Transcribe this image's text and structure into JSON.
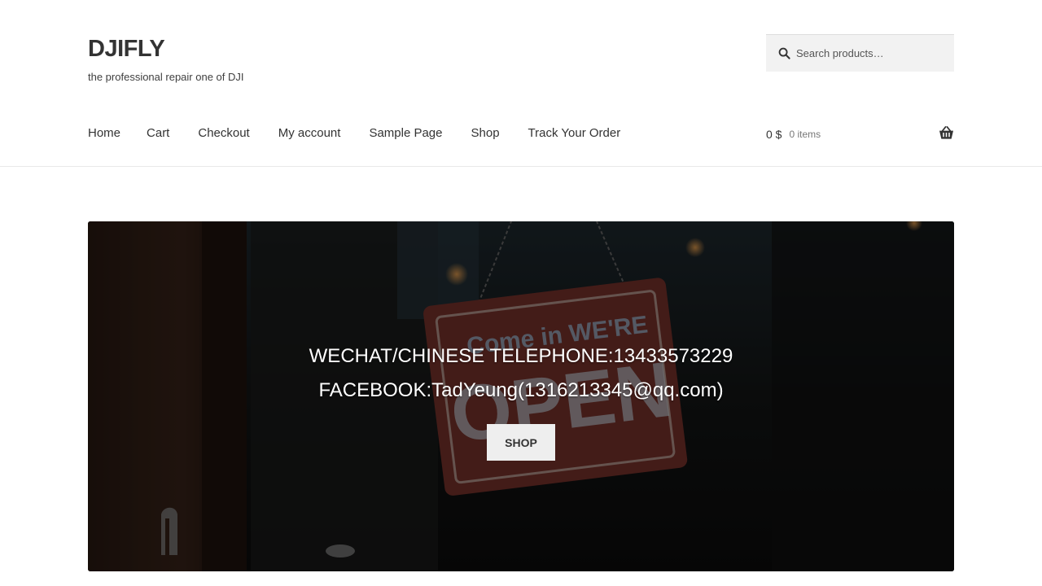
{
  "branding": {
    "title": "DJIFLY",
    "tagline": "the professional repair one of DJI"
  },
  "search": {
    "placeholder": "Search products…",
    "icon": "search-icon"
  },
  "nav": {
    "items": [
      {
        "label": "Home"
      },
      {
        "label": "Cart"
      },
      {
        "label": "Checkout"
      },
      {
        "label": "My account"
      },
      {
        "label": "Sample Page"
      },
      {
        "label": "Shop"
      },
      {
        "label": "Track Your Order"
      }
    ]
  },
  "cart": {
    "amount": "0 $",
    "count": "0 items",
    "icon": "basket-icon"
  },
  "hero": {
    "line1": "WECHAT/CHINESE TELEPHONE:13433573229",
    "line2": "FACEBOOK:TadYeung(1316213345@qq.com)",
    "button_label": "SHOP",
    "sign_text_1": "Come in WE'RE",
    "sign_text_2": "OPEN"
  },
  "colors": {
    "accent": "#333333",
    "hero_overlay": "#151515",
    "sign_red": "#8a3a33",
    "button_bg": "#eeeeee"
  }
}
